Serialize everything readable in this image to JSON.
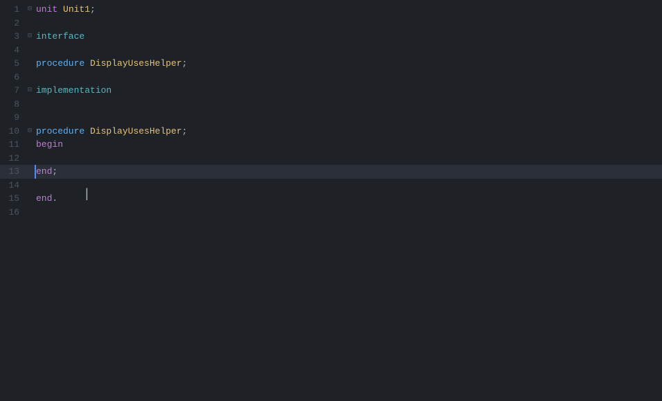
{
  "editor": {
    "background": "#1e2227",
    "lines": [
      {
        "num": 1,
        "fold": "⊟",
        "content": [
          {
            "type": "kw-unit",
            "text": "unit"
          },
          {
            "type": "text",
            "text": " "
          },
          {
            "type": "kw-name",
            "text": "Unit1"
          },
          {
            "type": "punct",
            "text": ";"
          }
        ],
        "active": false
      },
      {
        "num": 2,
        "fold": "",
        "content": [],
        "active": false
      },
      {
        "num": 3,
        "fold": "⊟",
        "content": [
          {
            "type": "kw-iface",
            "text": "interface"
          }
        ],
        "active": false
      },
      {
        "num": 4,
        "fold": "",
        "content": [],
        "active": false
      },
      {
        "num": 5,
        "fold": "",
        "content": [
          {
            "type": "kw-proc",
            "text": "procedure"
          },
          {
            "type": "text",
            "text": " "
          },
          {
            "type": "ident",
            "text": "DisplayUsesHelper"
          },
          {
            "type": "punct",
            "text": ";"
          }
        ],
        "active": false
      },
      {
        "num": 6,
        "fold": "",
        "content": [],
        "active": false
      },
      {
        "num": 7,
        "fold": "⊟",
        "content": [
          {
            "type": "kw-impl",
            "text": "implementation"
          }
        ],
        "active": false
      },
      {
        "num": 8,
        "fold": "",
        "content": [],
        "active": false
      },
      {
        "num": 9,
        "fold": "",
        "content": [],
        "active": false
      },
      {
        "num": 10,
        "fold": "⊟",
        "content": [
          {
            "type": "kw-proc",
            "text": "procedure"
          },
          {
            "type": "text",
            "text": " "
          },
          {
            "type": "ident",
            "text": "DisplayUsesHelper"
          },
          {
            "type": "punct",
            "text": ";"
          }
        ],
        "active": false
      },
      {
        "num": 11,
        "fold": "",
        "content": [
          {
            "type": "kw-begin",
            "text": "begin"
          }
        ],
        "active": false
      },
      {
        "num": 12,
        "fold": "",
        "content": [],
        "active": false
      },
      {
        "num": 13,
        "fold": "",
        "content": [
          {
            "type": "kw-end",
            "text": "end"
          },
          {
            "type": "punct",
            "text": ";"
          }
        ],
        "active": true
      },
      {
        "num": 14,
        "fold": "",
        "content": [],
        "active": false
      },
      {
        "num": 15,
        "fold": "",
        "content": [
          {
            "type": "kw-end",
            "text": "end"
          },
          {
            "type": "punct",
            "text": "."
          }
        ],
        "active": false
      },
      {
        "num": 16,
        "fold": "",
        "content": [],
        "active": false
      }
    ]
  }
}
